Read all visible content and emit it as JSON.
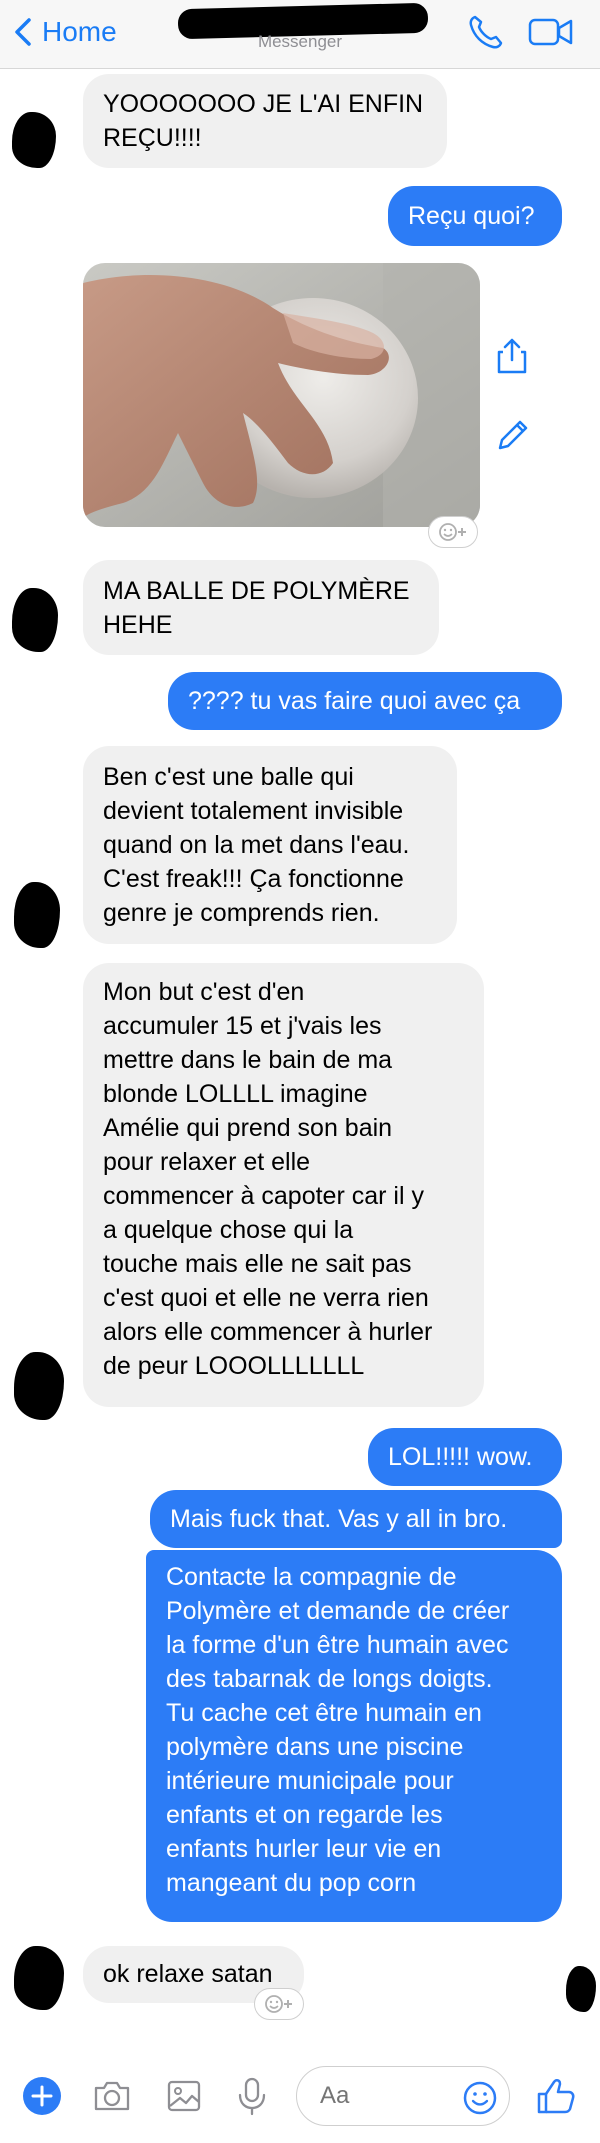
{
  "header": {
    "back_label": "Home",
    "subtitle": "Messenger"
  },
  "messages": [
    {
      "side": "in",
      "text": "YOOOOOOO JE L'AI ENFIN\nREÇU!!!!"
    },
    {
      "side": "out",
      "text": "Reçu quoi?"
    },
    {
      "side": "in",
      "type": "photo",
      "description": "hand holding clear polymer ball"
    },
    {
      "side": "in",
      "text": "MA BALLE DE POLYMÈRE\nHEHE"
    },
    {
      "side": "out",
      "text": "???? tu vas faire quoi avec ça"
    },
    {
      "side": "in",
      "text": "Ben c'est une balle qui\ndevient totalement invisible\nquand on la met dans l'eau.\nC'est freak!!! Ça fonctionne\ngenre je comprends rien."
    },
    {
      "side": "in",
      "text": "Mon but c'est d'en\naccumuler 15 et j'vais les\nmettre dans le bain de ma\nblonde LOLLLL imagine\nAmélie qui prend son bain\npour relaxer et elle\ncommencer à capoter car il y\na quelque chose qui la\ntouche mais elle ne sait pas\nc'est quoi et elle ne verra rien\nalors elle commencer à hurler\nde peur LOOOLLLLLLL"
    },
    {
      "side": "out",
      "text": "LOL!!!!! wow."
    },
    {
      "side": "out",
      "text": "Mais fuck that. Vas y all in bro."
    },
    {
      "side": "out",
      "text": "Contacte la compagnie de\nPolymère et demande de créer\nla forme d'un être humain avec\ndes tabarnak de longs doigts.\nTu cache cet être humain en\npolymère dans une piscine\nintérieure municipale pour\nenfants et on regarde les\nenfants hurler leur vie en\nmangeant du pop corn"
    },
    {
      "side": "in",
      "text": "ok relaxe satan"
    }
  ],
  "composer": {
    "placeholder": "Aa"
  },
  "colors": {
    "accent": "#1a7cf5",
    "outgoing_bubble": "#2c7cf6",
    "incoming_bubble": "#f0f0f0"
  },
  "icons": [
    "chevron-left-icon",
    "phone-icon",
    "video-camera-icon",
    "share-icon",
    "pencil-icon",
    "add-reaction-icon",
    "plus-icon",
    "camera-icon",
    "image-icon",
    "microphone-icon",
    "emoji-icon",
    "thumbs-up-icon"
  ]
}
